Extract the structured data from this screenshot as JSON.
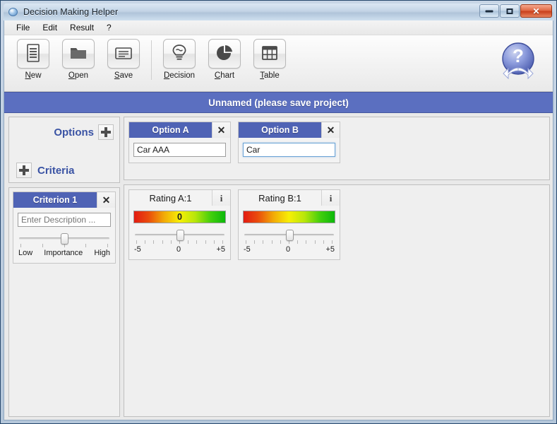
{
  "window": {
    "title": "Decision Making Helper",
    "icon": "app-globe-icon",
    "minimize_label": "Minimize",
    "maximize_label": "Maximize",
    "close_label": "Close"
  },
  "menubar": {
    "items": [
      {
        "label": "File"
      },
      {
        "label": "Edit"
      },
      {
        "label": "Result"
      },
      {
        "label": "?"
      }
    ]
  },
  "toolbar": {
    "buttons": [
      {
        "label": "New",
        "mnemonic": "N",
        "rest": "ew",
        "icon": "document-icon"
      },
      {
        "label": "Open",
        "mnemonic": "O",
        "rest": "pen",
        "icon": "folder-open-icon"
      },
      {
        "label": "Save",
        "mnemonic": "S",
        "rest": "ave",
        "icon": "folder-save-icon"
      },
      {
        "label": "Decision",
        "mnemonic": "D",
        "rest": "ecision",
        "icon": "lightbulb-icon"
      },
      {
        "label": "Chart",
        "mnemonic": "C",
        "rest": "hart",
        "icon": "pie-chart-icon"
      },
      {
        "label": "Table",
        "mnemonic": "T",
        "rest": "able",
        "icon": "table-grid-icon"
      }
    ],
    "help": {
      "icon": "help-question-icon",
      "label": "Help"
    }
  },
  "project": {
    "banner": "Unnamed (please save project)"
  },
  "sidebar": {
    "options_header": "Options",
    "options_add_icon": "plus-icon",
    "criteria_header": "Criteria",
    "criteria_add_icon": "plus-icon",
    "criteria": [
      {
        "title": "Criterion 1",
        "close_icon": "close-x-icon",
        "description_value": "",
        "description_placeholder": "Enter Description ...",
        "slider": {
          "value": 50,
          "min_label": "Low",
          "mid_label": "Importance",
          "max_label": "High",
          "tick_count": 5
        }
      }
    ]
  },
  "options": {
    "cards": [
      {
        "title": "Option A",
        "close_icon": "close-x-icon",
        "value": "Car AAA",
        "placeholder": "",
        "focused": false
      },
      {
        "title": "Option B",
        "close_icon": "close-x-icon",
        "value": "Car ",
        "placeholder": "",
        "focused": true
      }
    ]
  },
  "ratings": {
    "cards": [
      {
        "title": "Rating A:1",
        "info_icon": "info-icon",
        "bar_value": "0",
        "show_bar_value": true,
        "slider": {
          "value": 50,
          "tick_count": 11
        },
        "scale": {
          "min": "-5",
          "mid": "0",
          "max": "+5"
        }
      },
      {
        "title": "Rating B:1",
        "info_icon": "info-icon",
        "bar_value": "",
        "show_bar_value": false,
        "slider": {
          "value": 50,
          "tick_count": 11
        },
        "scale": {
          "min": "-5",
          "mid": "0",
          "max": "+5"
        }
      }
    ]
  },
  "colors": {
    "accent_blue": "#4f63b5",
    "banner_blue": "#5b6fc0",
    "header_text_blue": "#3a53a4",
    "gradient_low": "#e21b12",
    "gradient_mid": "#f7ef05",
    "gradient_high": "#0bb80b",
    "window_frame": "#27486d",
    "close_button_red": "#c9401c"
  }
}
